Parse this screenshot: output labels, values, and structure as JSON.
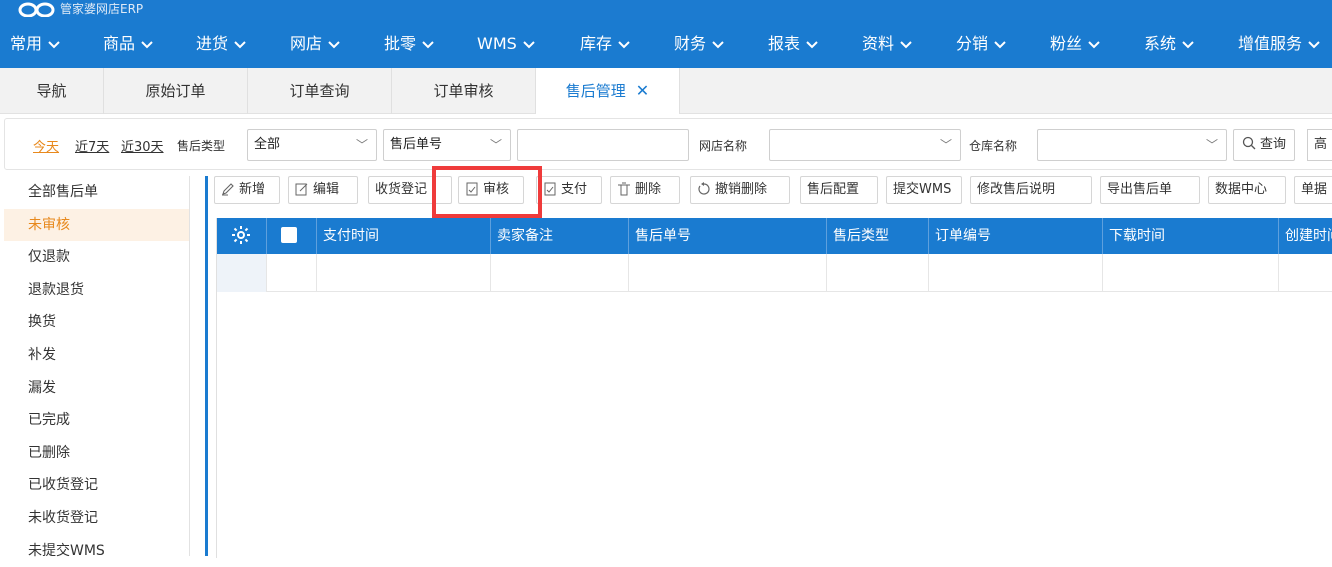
{
  "brand": {
    "title": "管家婆网店ERP"
  },
  "menu": [
    {
      "label": "常用"
    },
    {
      "label": "商品"
    },
    {
      "label": "进货"
    },
    {
      "label": "网店"
    },
    {
      "label": "批零"
    },
    {
      "label": "WMS"
    },
    {
      "label": "库存"
    },
    {
      "label": "财务"
    },
    {
      "label": "报表"
    },
    {
      "label": "资料"
    },
    {
      "label": "分销"
    },
    {
      "label": "粉丝"
    },
    {
      "label": "系统"
    },
    {
      "label": "增值服务"
    }
  ],
  "tabs": [
    {
      "label": "导航"
    },
    {
      "label": "原始订单"
    },
    {
      "label": "订单查询"
    },
    {
      "label": "订单审核"
    },
    {
      "label": "售后管理",
      "active": true
    }
  ],
  "filter": {
    "today": "今天",
    "last7": "近7天",
    "last30": "近30天",
    "type_label": "售后类型",
    "type_value": "全部",
    "field_value": "售后单号",
    "keyword_value": "",
    "shop_label": "网店名称",
    "shop_value": "",
    "warehouse_label": "仓库名称",
    "warehouse_value": "",
    "query_label": "查询",
    "more_label": "高"
  },
  "sidebar": {
    "items": [
      {
        "label": "全部售后单"
      },
      {
        "label": "未审核",
        "active": true
      },
      {
        "label": "仅退款"
      },
      {
        "label": "退款退货"
      },
      {
        "label": "换货"
      },
      {
        "label": "补发"
      },
      {
        "label": "漏发"
      },
      {
        "label": "已完成"
      },
      {
        "label": "已删除"
      },
      {
        "label": "已收货登记"
      },
      {
        "label": "未收货登记"
      },
      {
        "label": "未提交WMS"
      }
    ]
  },
  "toolbar": {
    "add": "新增",
    "edit": "编辑",
    "receive": "收货登记",
    "audit": "审核",
    "pay": "支付",
    "delete": "删除",
    "undo_delete": "撤销删除",
    "config": "售后配置",
    "submit_wms": "提交WMS",
    "modify_desc": "修改售后说明",
    "export": "导出售后单",
    "data_center": "数据中心",
    "bill": "单据"
  },
  "grid": {
    "columns": [
      "支付时间",
      "卖家备注",
      "售后单号",
      "售后类型",
      "订单编号",
      "下载时间",
      "创建时间"
    ]
  },
  "colors": {
    "primary": "#1a7bd0",
    "accent": "#e8891d",
    "highlight": "#ef3b3b"
  }
}
